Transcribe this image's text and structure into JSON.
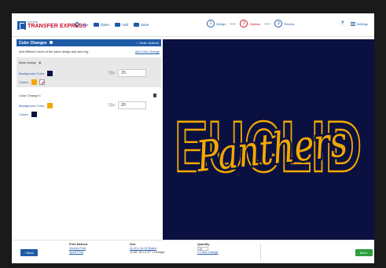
{
  "brand": {
    "small": "CUSTOM",
    "name": "TRANSFER EXPRESS"
  },
  "toolbar": {
    "new": "New",
    "open": "Open",
    "add": "Add",
    "save": "Save"
  },
  "steps": [
    {
      "num": "1",
      "label": "Design"
    },
    {
      "num": "2",
      "label": "Options"
    },
    {
      "num": "3",
      "label": "Review"
    }
  ],
  "header_right": {
    "help": "?",
    "settings": "Settings"
  },
  "panel": {
    "title": "Color Changes",
    "order_options": "Order Options",
    "subtitle": "Add different colors of the same design and save big",
    "add_link": "Add Color Change",
    "base": {
      "title": "Base design",
      "bg_label": "Background Color:",
      "colors_label": "Colors:",
      "qty_label": "Qty:",
      "qty_value": "15",
      "bg_color": "#0a1040",
      "color_swatch": "#f2a800"
    },
    "change1": {
      "title": "Color Change 1",
      "bg_label": "Background Color:",
      "colors_label": "Colors:",
      "qty_label": "Qty:",
      "qty_value": "20",
      "bg_color": "#f2a800",
      "color_swatch": "#0a1040"
    }
  },
  "design": {
    "word1": "EUCLID",
    "word2": "Panthers",
    "bg": "#0a1040",
    "ink": "#f2a800"
  },
  "footer": {
    "back": "Back",
    "next": "Next",
    "print_method": {
      "head": "Print Method",
      "opt1": "Screen Print",
      "opt2": "Sport Print"
    },
    "size": {
      "head": "Size",
      "link": "11.20 x 14.92 Board",
      "design": "11.96\" W x 6.37\" H Design"
    },
    "quantity": {
      "head": "Quantity",
      "value": "15",
      "link": "1 Color Change"
    }
  }
}
